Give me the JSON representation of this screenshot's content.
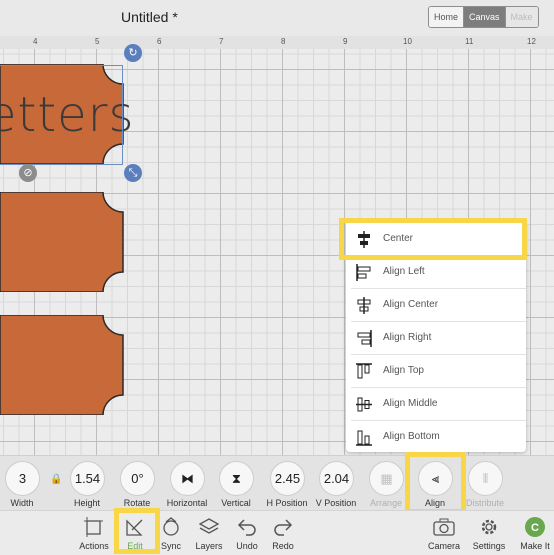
{
  "header": {
    "title": "Untitled *",
    "tabs": [
      {
        "label": "Home",
        "state": "normal"
      },
      {
        "label": "Canvas",
        "state": "active"
      },
      {
        "label": "Make",
        "state": "disabled"
      }
    ]
  },
  "ruler": {
    "labels": [
      "4",
      "5",
      "6",
      "7",
      "8",
      "9",
      "10",
      "11",
      "12"
    ]
  },
  "canvas": {
    "text": "etters",
    "shape_color": "#c8693a"
  },
  "align_menu": {
    "items": [
      {
        "label": "Center",
        "icon": "center-icon"
      },
      {
        "label": "Align Left",
        "icon": "align-left-icon"
      },
      {
        "label": "Align Center",
        "icon": "align-center-icon"
      },
      {
        "label": "Align Right",
        "icon": "align-right-icon"
      },
      {
        "label": "Align Top",
        "icon": "align-top-icon"
      },
      {
        "label": "Align Middle",
        "icon": "align-middle-icon"
      },
      {
        "label": "Align Bottom",
        "icon": "align-bottom-icon"
      }
    ]
  },
  "edit_toolbar": {
    "width": {
      "value": "3",
      "label": "Width"
    },
    "height": {
      "value": "1.54",
      "label": "Height"
    },
    "rotate": {
      "value": "0°",
      "label": "Rotate"
    },
    "horizontal": {
      "label": "Horizontal"
    },
    "vertical": {
      "label": "Vertical"
    },
    "hpos": {
      "value": "2.45",
      "label": "H Position"
    },
    "vpos": {
      "value": "2.04",
      "label": "V Position"
    },
    "arrange": {
      "label": "Arrange"
    },
    "align": {
      "label": "Align"
    },
    "distribute": {
      "label": "Distribute"
    }
  },
  "bottom_bar": {
    "actions": "Actions",
    "edit": "Edit",
    "sync": "Sync",
    "layers": "Layers",
    "undo": "Undo",
    "redo": "Redo",
    "camera": "Camera",
    "settings": "Settings",
    "make_it": "Make It"
  },
  "colors": {
    "highlight": "#f9d548",
    "selection": "#5b7fbd",
    "shape": "#c8693a",
    "active_tab": "#7d7d7d",
    "edit_green": "#6aa84f"
  }
}
